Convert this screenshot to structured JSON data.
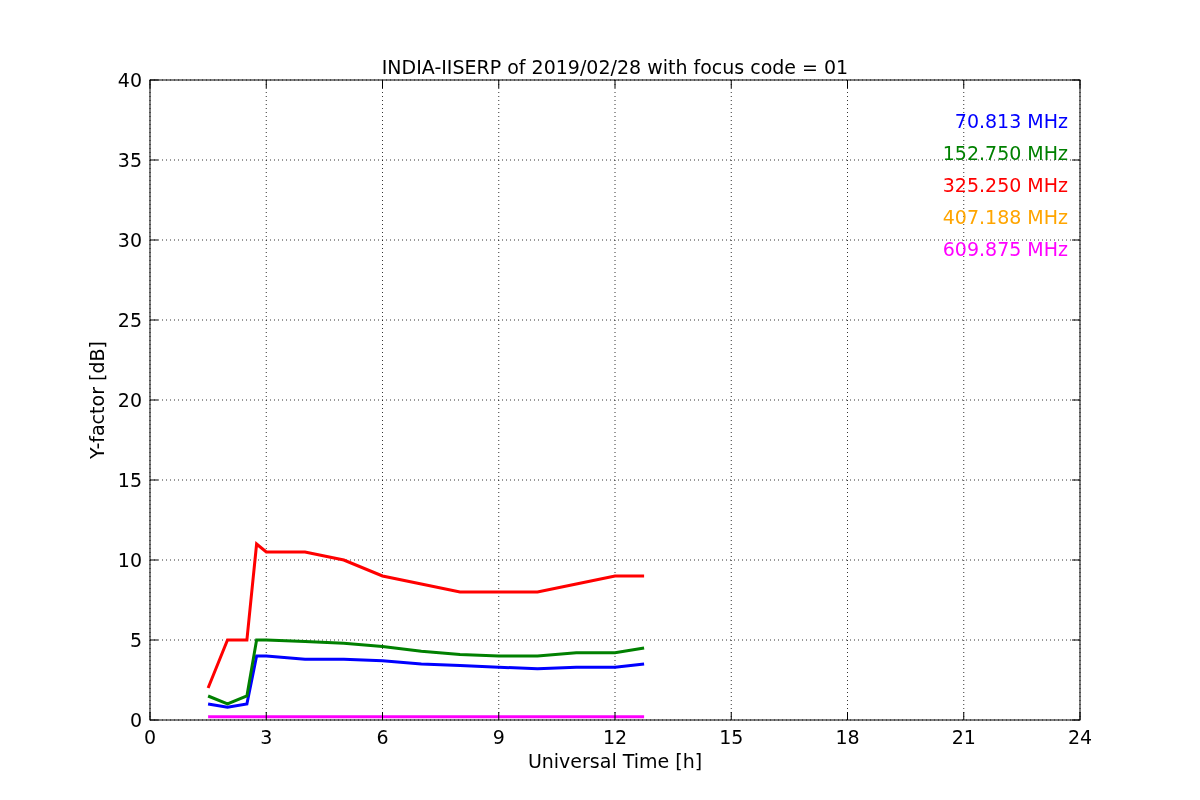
{
  "chart_data": {
    "type": "line",
    "title": "INDIA-IISERP of 2019/02/28 with focus code = 01",
    "xlabel": "Universal Time [h]",
    "ylabel": "Y-factor [dB]",
    "x": [
      1.5,
      2,
      2.5,
      2.75,
      3,
      4,
      5,
      6,
      7,
      8,
      9,
      10,
      11,
      12,
      12.75
    ],
    "series": [
      {
        "name": "70.813 MHz",
        "color": "#0000ff",
        "values": [
          1.0,
          0.8,
          1.0,
          4.0,
          4.0,
          3.8,
          3.8,
          3.7,
          3.5,
          3.4,
          3.3,
          3.2,
          3.3,
          3.3,
          3.5
        ]
      },
      {
        "name": "152.750 MHz",
        "color": "#008000",
        "values": [
          1.5,
          1.0,
          1.5,
          5.0,
          5.0,
          4.9,
          4.8,
          4.6,
          4.3,
          4.1,
          4.0,
          4.0,
          4.2,
          4.2,
          4.5
        ]
      },
      {
        "name": "325.250 MHz",
        "color": "#ff0000",
        "values": [
          2.0,
          5.0,
          5.0,
          11.0,
          10.5,
          10.5,
          10.0,
          9.0,
          8.5,
          8.0,
          8.0,
          8.0,
          8.5,
          9.0,
          9.0
        ]
      },
      {
        "name": "407.188 MHz",
        "color": "#ffa500",
        "values": [
          null,
          null,
          null,
          null,
          null,
          null,
          null,
          null,
          null,
          null,
          null,
          null,
          null,
          null,
          null
        ]
      },
      {
        "name": "609.875 MHz",
        "color": "#ff00ff",
        "values": [
          0.2,
          0.2,
          0.2,
          0.2,
          0.2,
          0.2,
          0.2,
          0.2,
          0.2,
          0.2,
          0.2,
          0.2,
          0.2,
          0.2,
          0.2
        ]
      }
    ],
    "grid": true,
    "xlim": [
      0,
      24
    ],
    "ylim": [
      0,
      40
    ],
    "xticks": [
      0,
      3,
      6,
      9,
      12,
      15,
      18,
      21,
      24
    ],
    "yticks": [
      0,
      5,
      10,
      15,
      20,
      25,
      30,
      35,
      40
    ]
  }
}
